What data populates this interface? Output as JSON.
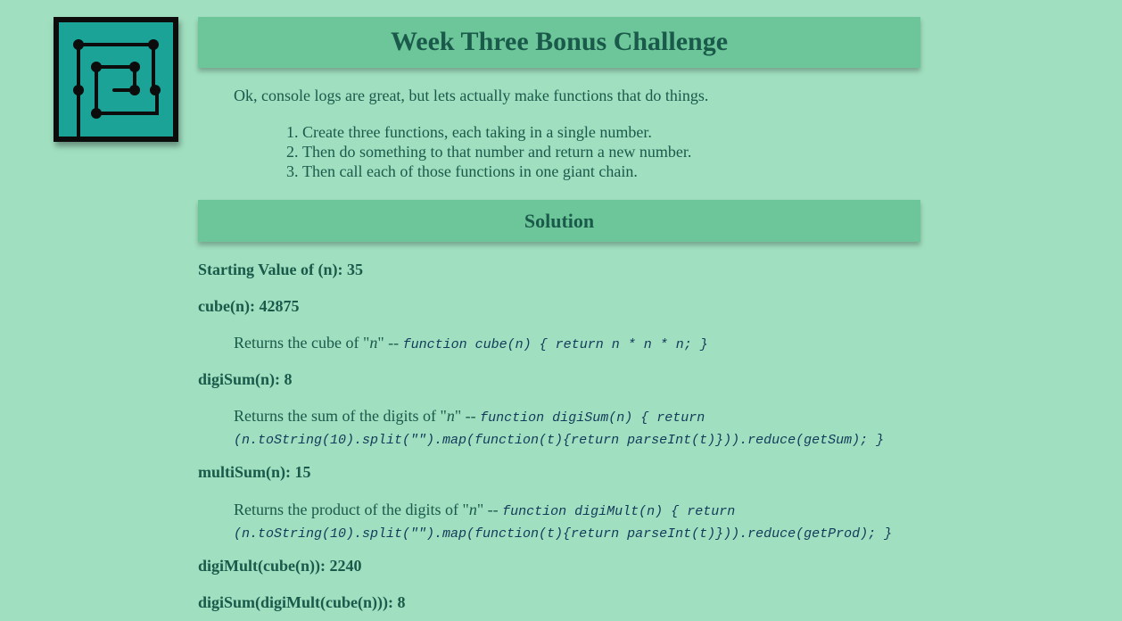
{
  "logo": {
    "icon": "maze-icon",
    "bg": "#1aa396",
    "fg": "#0c0c0c"
  },
  "header": {
    "title": "Week Three Bonus Challenge"
  },
  "intro": "Ok, console logs are great, but lets actually make functions that do things.",
  "steps": [
    "Create three functions, each taking in a single number.",
    "Then do something to that number and return a new number.",
    "Then call each of those functions in one giant chain."
  ],
  "solution": {
    "heading": "Solution"
  },
  "results": {
    "start": "Starting Value of (n): 35",
    "cube": "cube(n): 42875",
    "cube_desc_prefix": "Returns the cube of \"",
    "cube_desc_var": "n",
    "cube_desc_suffix": "\" -- ",
    "cube_code": "function cube(n) { return n * n * n; }",
    "digisum": "digiSum(n): 8",
    "digisum_desc_prefix": "Returns the sum of the digits of \"",
    "digisum_desc_var": "n",
    "digisum_desc_suffix": "\" -- ",
    "digisum_code": "function digiSum(n) { return (n.toString(10).split(\"\").map(function(t){return parseInt(t)})).reduce(getSum); }",
    "multisum": "multiSum(n): 15",
    "multisum_desc_prefix": "Returns the product of the digits of \"",
    "multisum_desc_var": "n",
    "multisum_desc_suffix": "\" -- ",
    "multisum_code": "function digiMult(n) { return (n.toString(10).split(\"\").map(function(t){return parseInt(t)})).reduce(getProd); }",
    "digimult_cube": "digiMult(cube(n)): 2240",
    "digisum_chain": "digiSum(digiMult(cube(n))): 8"
  }
}
